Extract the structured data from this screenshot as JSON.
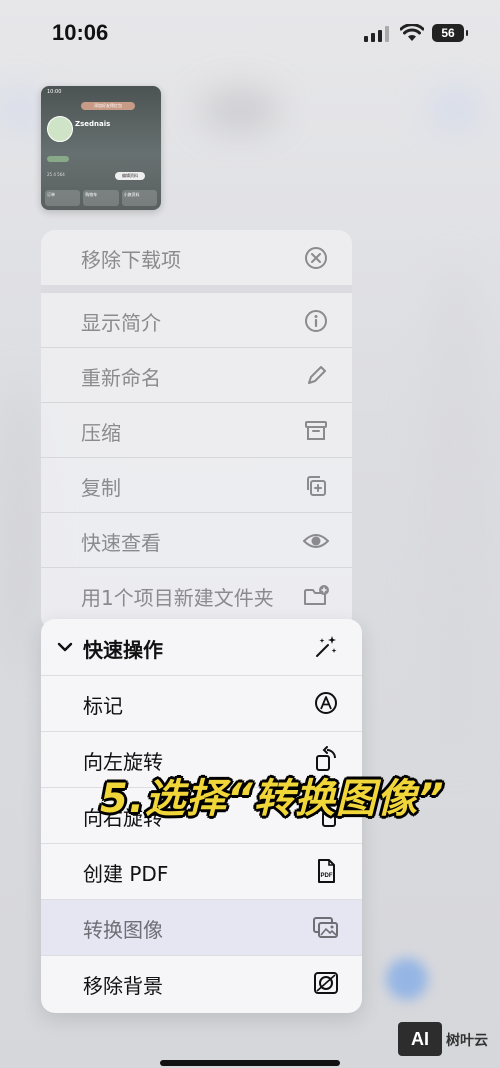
{
  "status_bar": {
    "time": "10:06",
    "battery": "56"
  },
  "thumbnail": {
    "time": "10:00",
    "badge": "添加好友得红包",
    "username": "Zsednais",
    "edit_button": "编辑资料",
    "stats": "25  4  564",
    "cards": [
      "订单",
      "购物车",
      "小旗资料"
    ]
  },
  "menu_primary": {
    "items": [
      {
        "label": "移除下载项",
        "icon": "remove-download-icon"
      },
      {
        "label": "显示简介",
        "icon": "info-icon"
      },
      {
        "label": "重新命名",
        "icon": "pencil-icon"
      },
      {
        "label": "压缩",
        "icon": "archive-icon"
      },
      {
        "label": "复制",
        "icon": "duplicate-icon"
      },
      {
        "label": "快速查看",
        "icon": "eye-icon"
      },
      {
        "label": "用1个项目新建文件夹",
        "icon": "new-folder-icon"
      }
    ]
  },
  "menu_quick_actions": {
    "header": "快速操作",
    "header_icon": "sparkles-icon",
    "items": [
      {
        "label": "标记",
        "icon": "markup-icon"
      },
      {
        "label": "向左旋转",
        "icon": "rotate-left-icon"
      },
      {
        "label": "向右旋转",
        "icon": "rotate-right-icon"
      },
      {
        "label": "创建 PDF",
        "icon": "pdf-icon"
      },
      {
        "label": "转换图像",
        "icon": "convert-image-icon"
      },
      {
        "label": "移除背景",
        "icon": "remove-background-icon"
      }
    ]
  },
  "overlay_caption": "5.选择“转换图像”",
  "watermark": {
    "logo": "AI",
    "text": "树叶云"
  }
}
